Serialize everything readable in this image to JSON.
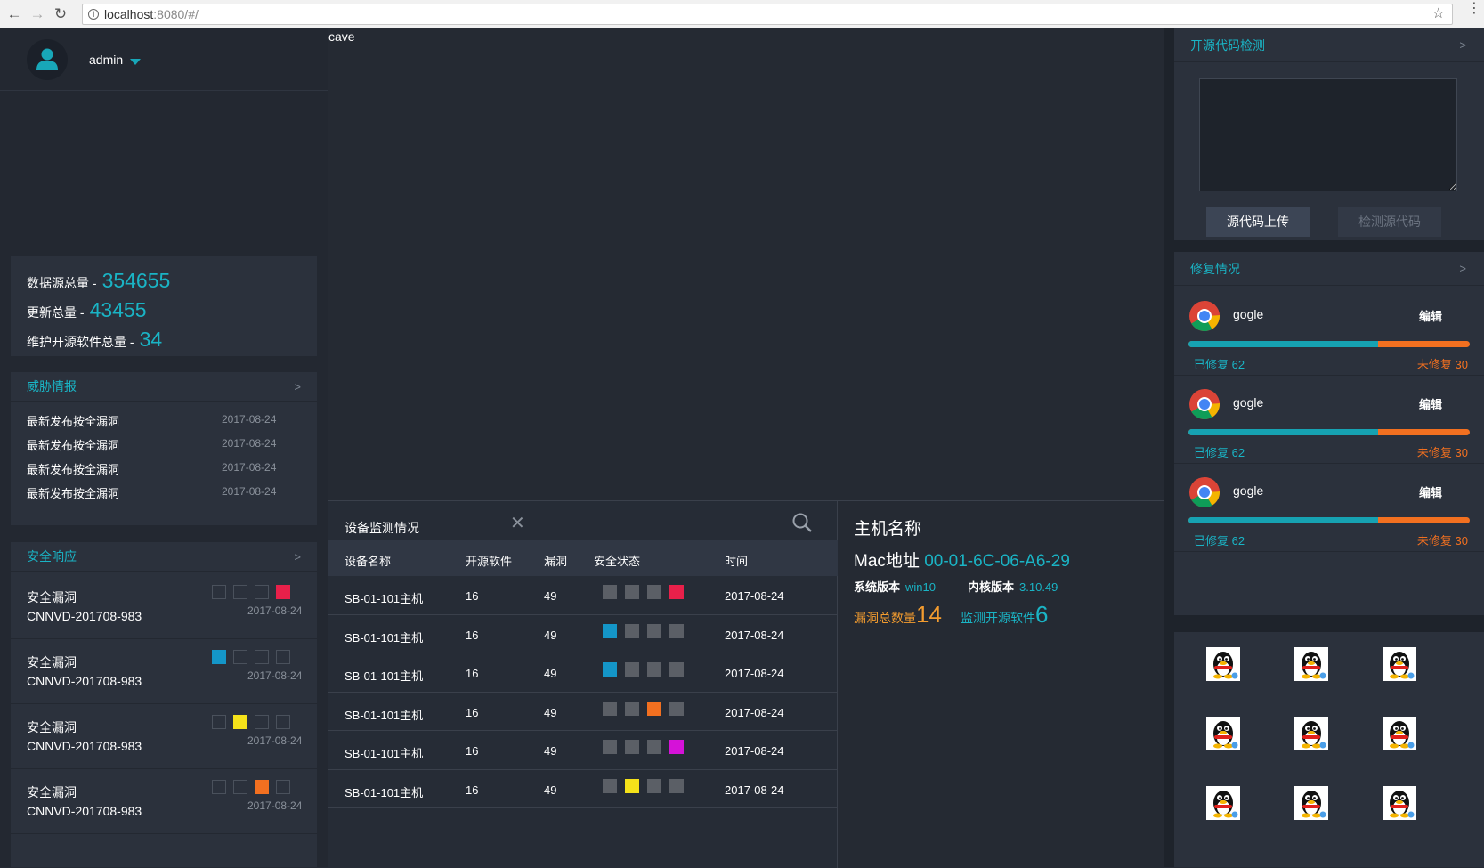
{
  "browser": {
    "url_host": "localhost",
    "url_rest": ":8080/#/",
    "info_glyph": "i",
    "back_glyph": "←",
    "forward_glyph": "→",
    "reload_glyph": "↻",
    "star_glyph": "☆",
    "menu_glyph": "⋮"
  },
  "user": {
    "name": "admin"
  },
  "stats": [
    {
      "label": "数据源总量 -",
      "value": "354655"
    },
    {
      "label": "更新总量 -",
      "value": "43455"
    },
    {
      "label": "维护开源软件总量 -",
      "value": "34"
    }
  ],
  "threat": {
    "title": "威胁情报",
    "more": ">",
    "items": [
      {
        "text": "最新发布按全漏洞",
        "date": "2017-08-24"
      },
      {
        "text": "最新发布按全漏洞",
        "date": "2017-08-24"
      },
      {
        "text": "最新发布按全漏洞",
        "date": "2017-08-24"
      },
      {
        "text": "最新发布按全漏洞",
        "date": "2017-08-24"
      }
    ]
  },
  "response": {
    "title": "安全响应",
    "more": ">",
    "items": [
      {
        "title": "安全漏洞",
        "id": "CNNVD-201708-983",
        "date": "2017-08-24",
        "active": 3,
        "color": "#e8204a"
      },
      {
        "title": "安全漏洞",
        "id": "CNNVD-201708-983",
        "date": "2017-08-24",
        "active": 0,
        "color": "#1496c8"
      },
      {
        "title": "安全漏洞",
        "id": "CNNVD-201708-983",
        "date": "2017-08-24",
        "active": 1,
        "color": "#f5e21a"
      },
      {
        "title": "安全漏洞",
        "id": "CNNVD-201708-983",
        "date": "2017-08-24",
        "active": 2,
        "color": "#f27020"
      }
    ]
  },
  "middle": {
    "canvas_label": "cave"
  },
  "device_table": {
    "title": "设备监测情况",
    "close": "✕",
    "columns": [
      "设备名称",
      "开源软件",
      "漏洞",
      "安全状态",
      "时间"
    ],
    "rows": [
      {
        "name": "SB-01-101主机",
        "software": "16",
        "vulns": "49",
        "active": 3,
        "color": "#e8204a",
        "time": "2017-08-24"
      },
      {
        "name": "SB-01-101主机",
        "software": "16",
        "vulns": "49",
        "active": 0,
        "color": "#1496c8",
        "time": "2017-08-24"
      },
      {
        "name": "SB-01-101主机",
        "software": "16",
        "vulns": "49",
        "active": 0,
        "color": "#1496c8",
        "time": "2017-08-24"
      },
      {
        "name": "SB-01-101主机",
        "software": "16",
        "vulns": "49",
        "active": 2,
        "color": "#f27020",
        "time": "2017-08-24"
      },
      {
        "name": "SB-01-101主机",
        "software": "16",
        "vulns": "49",
        "active": 3,
        "color": "#d512d8",
        "time": "2017-08-24"
      },
      {
        "name": "SB-01-101主机",
        "software": "16",
        "vulns": "49",
        "active": 1,
        "color": "#f5e21a",
        "time": "2017-08-24"
      }
    ]
  },
  "host": {
    "title": "主机名称",
    "mac_label": "Mac地址",
    "mac_value": "00-01-6C-06-A6-29",
    "os_label": "系统版本",
    "os_value": "win10",
    "kernel_label": "内核版本",
    "kernel_value": "3.10.49",
    "vuln_label": "漏洞总数量",
    "vuln_value": "14",
    "soft_label": "监测开源软件",
    "soft_value": "6"
  },
  "code_check": {
    "title": "开源代码检测",
    "more": ">",
    "upload_label": "源代码上传",
    "check_label": "检测源代码"
  },
  "repair": {
    "title": "修复情况",
    "more": ">",
    "items": [
      {
        "name": "gogle",
        "edit": "编辑",
        "fixed_label": "已修复 62",
        "unfixed_label": "未修复 30",
        "fixed": 62,
        "unfixed": 30
      },
      {
        "name": "gogle",
        "edit": "编辑",
        "fixed_label": "已修复 62",
        "unfixed_label": "未修复 30",
        "fixed": 62,
        "unfixed": 30
      },
      {
        "name": "gogle",
        "edit": "编辑",
        "fixed_label": "已修复 62",
        "unfixed_label": "未修复 30",
        "fixed": 62,
        "unfixed": 30
      }
    ]
  },
  "qq_icons": {
    "count": 9,
    "icon": "qq-penguin-icon"
  },
  "colors": {
    "accent": "#1ab4c5",
    "warning": "#f27020",
    "bg": "#252a33",
    "panel": "#2b313c"
  }
}
